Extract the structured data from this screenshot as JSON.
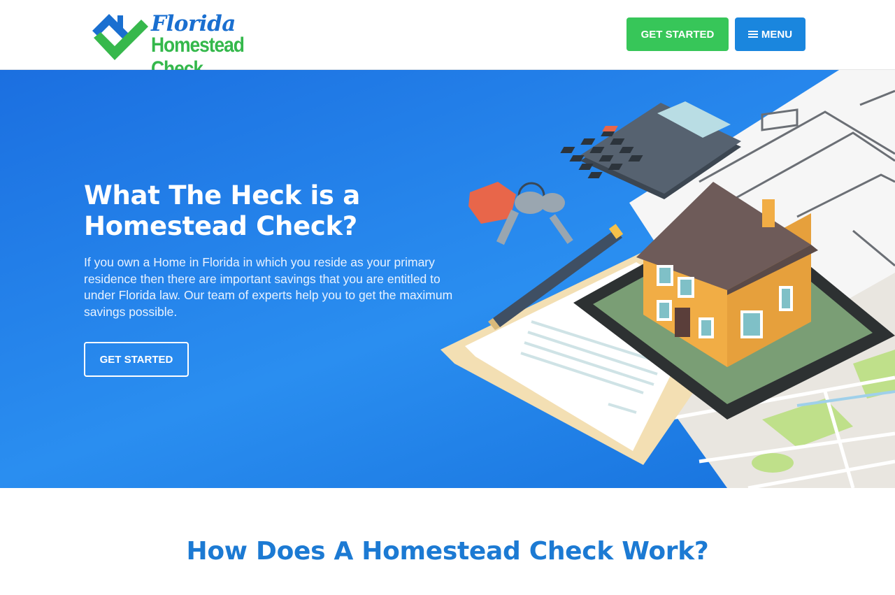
{
  "header": {
    "logo_line1": "Florida",
    "logo_line2": "Homestead Check",
    "get_started_label": "GET STARTED",
    "menu_label": "MENU"
  },
  "hero": {
    "title": "What The Heck is a Homestead Check?",
    "body": "If you own a Home in Florida in which you reside as your primary residence then there are important savings that you are entitled to under Florida law. Our team of experts help you to get the maximum savings possible.",
    "cta_label": "GET STARTED"
  },
  "section": {
    "title": "How Does A Homestead Check Work?"
  },
  "colors": {
    "brand_blue": "#1a86de",
    "brand_green": "#37c659",
    "hero_blue": "#2a8ef0",
    "heading_blue": "#1c7ad3"
  },
  "icons": [
    "house-checkmark-logo-icon",
    "hamburger-icon"
  ]
}
